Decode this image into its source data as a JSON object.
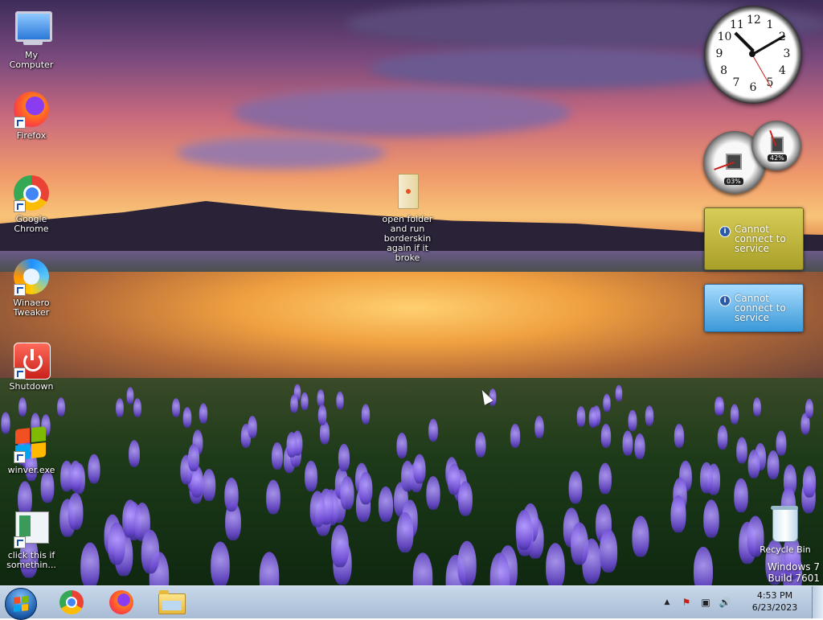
{
  "desktop": {
    "icons": [
      {
        "name": "my-computer-icon",
        "label_line1": "My",
        "label_line2": "Computer"
      },
      {
        "name": "firefox-icon",
        "label_line1": "Firefox",
        "label_line2": ""
      },
      {
        "name": "google-chrome-icon",
        "label_line1": "Google",
        "label_line2": "Chrome"
      },
      {
        "name": "winaero-tweaker-icon",
        "label_line1": "Winaero",
        "label_line2": "Tweaker"
      },
      {
        "name": "shutdown-icon",
        "label_line1": "Shutdown",
        "label_line2": ""
      },
      {
        "name": "winver-icon",
        "label_line1": "winver.exe",
        "label_line2": ""
      },
      {
        "name": "click-this-icon",
        "label_line1": "click this if",
        "label_line2": "somethin..."
      }
    ],
    "folder": {
      "label_lines": [
        "open folder",
        "and run",
        "borderskin",
        "again if it",
        "broke"
      ]
    },
    "recycle_bin": {
      "label": "Recycle Bin"
    },
    "watermark": {
      "line1": "Windows 7",
      "line2": "Build 7601"
    }
  },
  "gadgets": {
    "clock": {
      "numbers": [
        "12",
        "1",
        "2",
        "3",
        "4",
        "5",
        "6",
        "7",
        "8",
        "9",
        "10",
        "11"
      ]
    },
    "cpu_meter": {
      "cpu_percent": "03%",
      "memory_percent": "42%"
    },
    "weather_1": {
      "line1": "Cannot",
      "line2": "connect to",
      "line3": "service",
      "info_icon": "i"
    },
    "weather_2": {
      "line1": "Cannot",
      "line2": "connect to",
      "line3": "service",
      "info_icon": "i"
    }
  },
  "taskbar": {
    "pinned": [
      "chrome-icon",
      "firefox-icon",
      "file-explorer-icon"
    ],
    "tray": {
      "chevron": "▲",
      "action_center_icon": "⚑",
      "network_icon": "▣",
      "volume_icon": "🔊"
    },
    "clock": {
      "time": "4:53 PM",
      "date": "6/23/2023"
    }
  },
  "colors": {
    "taskbar": "#b8cbe0",
    "gadget_yellow": "#c8bc48",
    "gadget_blue": "#6ab8ee"
  }
}
